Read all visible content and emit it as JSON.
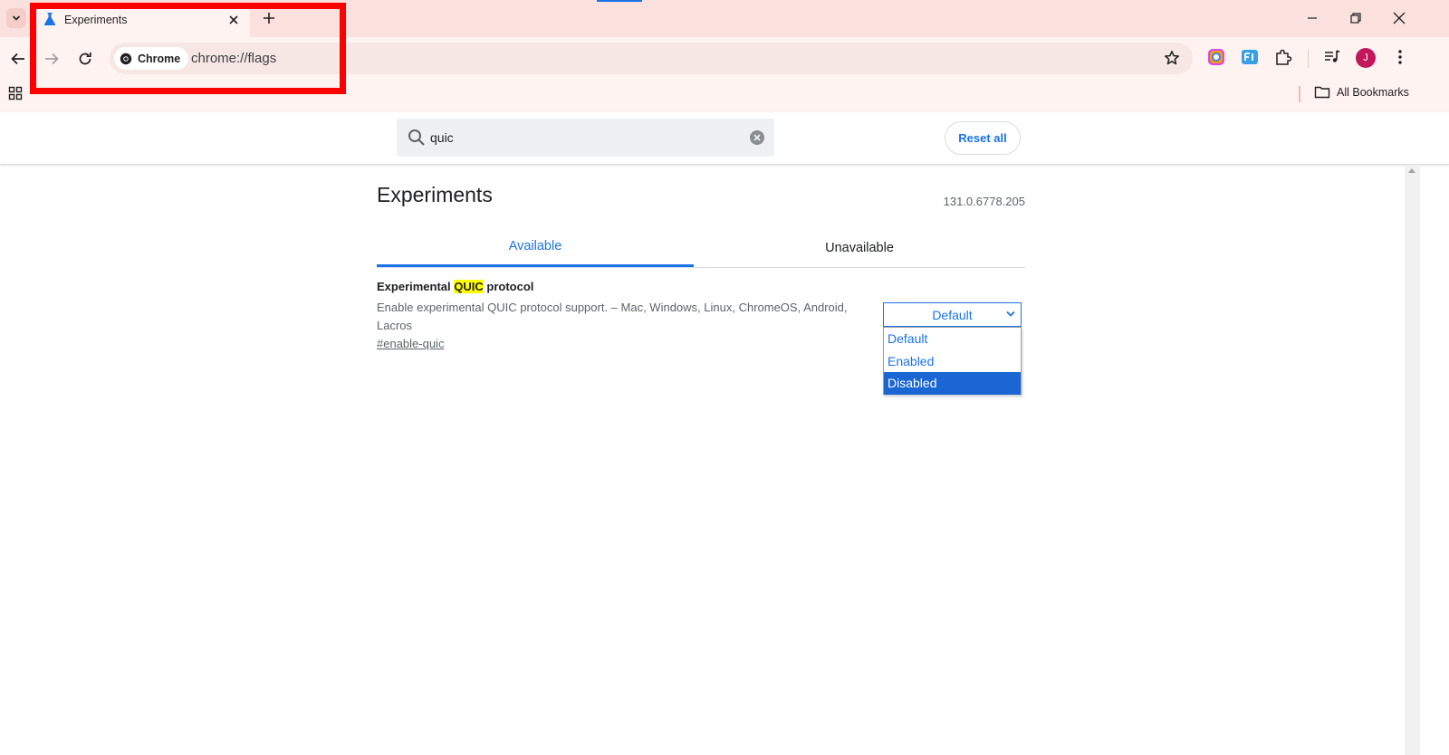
{
  "browser": {
    "tab": {
      "title": "Experiments"
    },
    "omnibox": {
      "chip_label": "Chrome",
      "url": "chrome://flags"
    },
    "profile_initial": "J",
    "bookmarks_bar": {
      "all_bookmarks_label": "All Bookmarks"
    }
  },
  "flags": {
    "search": {
      "value": "quic"
    },
    "reset_label": "Reset all",
    "page_title": "Experiments",
    "version": "131.0.6778.205",
    "tabs": {
      "available": "Available",
      "unavailable": "Unavailable"
    },
    "flag": {
      "title_before": "Experimental ",
      "title_highlight": "QUIC",
      "title_after": " protocol",
      "description": "Enable experimental QUIC protocol support. – Mac, Windows, Linux, ChromeOS, Android, Lacros",
      "link": "#enable-quic",
      "select": {
        "value": "Default",
        "options": [
          "Default",
          "Enabled",
          "Disabled"
        ],
        "hovered_option": "Disabled"
      }
    }
  },
  "colors": {
    "accent": "#1a73e8",
    "frame": "#fbe1de",
    "toolbar": "#fff3f1",
    "search_highlight": "#ffff00",
    "annotation_box": "#ff0000",
    "selected_option": "#1a66d2"
  }
}
